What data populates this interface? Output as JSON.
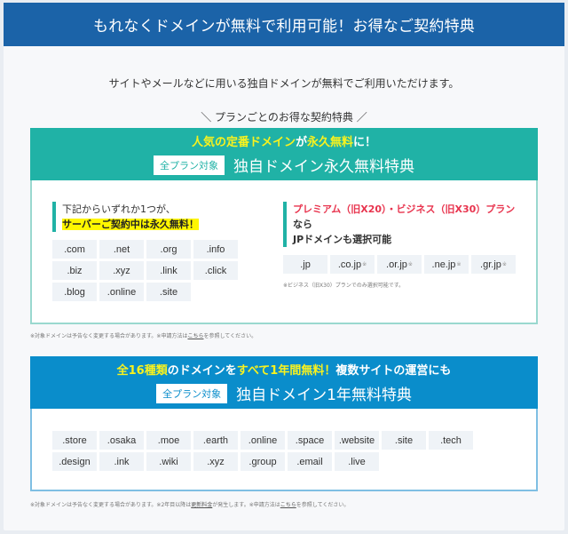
{
  "header": {
    "title": "もれなくドメインが無料で利用可能！お得なご契約特典"
  },
  "intro": "サイトやメールなどに用いる独自ドメインが無料でご利用いただけます。",
  "subhead": "＼ プランごとのお得な契約特典 ／",
  "colors": {
    "header": "#1b63a8",
    "teal": "#20b2a6",
    "blue": "#0a8dcb",
    "highlight_yellow": "#f9f21e",
    "red": "#e8344e"
  },
  "permanent": {
    "line1_parts": [
      "人気の定番ドメイン",
      "が",
      "永久無料",
      "に！"
    ],
    "badge": "全プラン対象",
    "title": "独自ドメイン永久無料特典",
    "left": {
      "lead_line1": "下記からいずれか1つが、",
      "lead_line2": "サーバーご契約中は永久無料！",
      "domains": [
        ".com",
        ".net",
        ".org",
        ".info",
        ".biz",
        ".xyz",
        ".link",
        ".click",
        ".blog",
        ".online",
        ".site"
      ]
    },
    "right": {
      "lead_red": "プレミアム（旧X20）・ビジネス（旧X30）プラン",
      "lead_suffix": "なら",
      "lead_line2": "JPドメインも選択可能",
      "domains": [
        {
          "name": ".jp",
          "mark": ""
        },
        {
          "name": ".co.jp",
          "mark": "※"
        },
        {
          "name": ".or.jp",
          "mark": "※"
        },
        {
          "name": ".ne.jp",
          "mark": "※"
        },
        {
          "name": ".gr.jp",
          "mark": "※"
        }
      ],
      "footnote": "※ビジネス（旧X30）プランでのみ選択可能です。"
    },
    "note_prefix": "※対象ドメインは予告なく変更する場合があります。※申請方法は",
    "note_link": "こちら",
    "note_suffix": "を参照してください。"
  },
  "one_year": {
    "line1_parts": [
      "全16種類",
      "のドメインを",
      "すべて1年間無料！",
      "複数サイトの運営にも"
    ],
    "badge": "全プラン対象",
    "title": "独自ドメイン1年無料特典",
    "domains": [
      ".store",
      ".osaka",
      ".moe",
      ".earth",
      ".online",
      ".space",
      ".website",
      ".site",
      ".tech",
      ".design",
      ".ink",
      ".wiki",
      ".xyz",
      ".group",
      ".email",
      ".live"
    ],
    "note_prefix": "※対象ドメインは予告なく変更する場合があります。※2年目以降は",
    "note_link1": "更新料金",
    "note_mid": "が発生します。※申請方法は",
    "note_link2": "こちら",
    "note_suffix": "を参照してください。"
  }
}
